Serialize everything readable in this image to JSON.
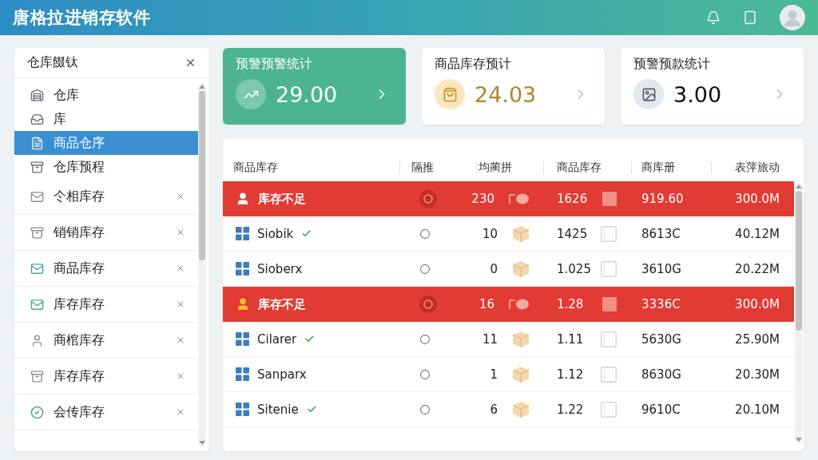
{
  "header": {
    "title": "唐格拉进销存软件"
  },
  "sidebar": {
    "title": "仓库餟钛",
    "items": [
      {
        "label": "仓库",
        "selected": false,
        "closable": false
      },
      {
        "label": "库",
        "selected": false,
        "closable": false
      },
      {
        "label": "商品仓序",
        "selected": true,
        "closable": false
      },
      {
        "label": "仓库预程",
        "selected": false,
        "closable": false
      },
      {
        "label": "仒相库存",
        "selected": false,
        "closable": true
      },
      {
        "label": "销销库存",
        "selected": false,
        "closable": true
      },
      {
        "label": "商品库存",
        "selected": false,
        "closable": true
      },
      {
        "label": "库存库存",
        "selected": false,
        "closable": true
      },
      {
        "label": "商棺库存",
        "selected": false,
        "closable": true
      },
      {
        "label": "库存库存",
        "selected": false,
        "closable": true
      },
      {
        "label": "会传库存",
        "selected": false,
        "closable": true
      }
    ]
  },
  "cards": [
    {
      "title": "预警预警统计",
      "value": "29.00",
      "selected": true,
      "color": "#ffffff"
    },
    {
      "title": "商品库存预计",
      "value": "24.03",
      "selected": false,
      "color": "#b0862a"
    },
    {
      "title": "预警预款统计",
      "value": "3.00",
      "selected": false,
      "color": "#111111"
    }
  ],
  "table": {
    "columns": [
      "商品库存",
      "隔推",
      "均蔺拼",
      "商品库存",
      "商库册",
      "表萍旅动"
    ],
    "rows": [
      {
        "kind": "alert",
        "color": "#ffffff",
        "verified": false,
        "cells": [
          "库存不足",
          "",
          "230",
          "1626",
          "919.60",
          "300.0M"
        ]
      },
      {
        "kind": "normal",
        "color": "#3a7bc2",
        "verified": true,
        "cells": [
          "Siobik",
          "",
          "10",
          "1425",
          "8613C",
          "40.12M"
        ]
      },
      {
        "kind": "normal",
        "color": "#3a7bc2",
        "verified": false,
        "cells": [
          "Sioberx",
          "",
          "0",
          "1.025",
          "3610G",
          "20.22M"
        ]
      },
      {
        "kind": "alert",
        "color": "#f5c02a",
        "verified": false,
        "cells": [
          "库存不足",
          "",
          "16",
          "1.28",
          "3336C",
          "300.0M"
        ]
      },
      {
        "kind": "normal",
        "color": "#3a7bc2",
        "verified": true,
        "cells": [
          "Cilarer",
          "",
          "11",
          "1.11",
          "5630G",
          "25.90M"
        ]
      },
      {
        "kind": "normal",
        "color": "#3a7bc2",
        "verified": false,
        "cells": [
          "Sanparx",
          "",
          "1",
          "1.12",
          "8630G",
          "20.30M"
        ]
      },
      {
        "kind": "normal",
        "color": "#3a7bc2",
        "verified": true,
        "cells": [
          "Sitenie",
          "",
          "6",
          "1.22",
          "9610C",
          "20.10M"
        ]
      }
    ]
  }
}
